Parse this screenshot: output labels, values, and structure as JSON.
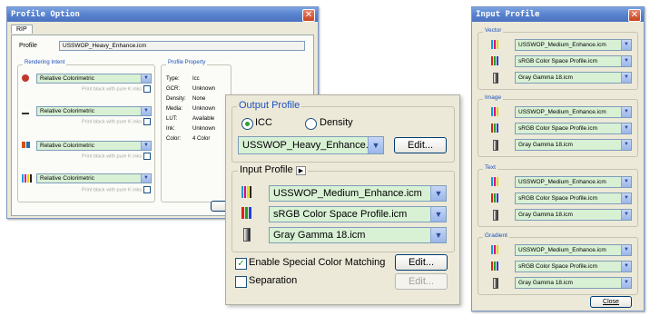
{
  "profile_option": {
    "title": "Profile Option",
    "tab": "RIP",
    "profile_label": "Profile",
    "profile_value": "USSWOP_Heavy_Enhance.icm",
    "rendering_intent": {
      "label": "Rendering Intent",
      "rows": [
        {
          "value": "Relative Colorimetric",
          "note": "Print black with pure K inks"
        },
        {
          "value": "Relative Colorimetric",
          "note": "Print black with pure K inks"
        },
        {
          "value": "Relative Colorimetric",
          "note": "Print black with pure K inks"
        },
        {
          "value": "Relative Colorimetric",
          "note": "Print black with pure K inks"
        }
      ]
    },
    "profile_property": {
      "label": "Profile Property",
      "rows": [
        {
          "key": "Type:",
          "value": "Icc"
        },
        {
          "key": "GCR:",
          "value": "Unknown"
        },
        {
          "key": "Density:",
          "value": "None"
        },
        {
          "key": "Media:",
          "value": "Unknown"
        },
        {
          "key": "LUT:",
          "value": "Available"
        },
        {
          "key": "Ink:",
          "value": "Unknown"
        },
        {
          "key": "Color:",
          "value": "4 Color"
        }
      ]
    },
    "partial_button": "C"
  },
  "output_profile": {
    "group_label": "Output Profile",
    "radio_icc": "ICC",
    "radio_density": "Density",
    "selected": "icc",
    "profile_value": "USSWOP_Heavy_Enhance.icr",
    "edit_button": "Edit...",
    "input_profile_label": "Input Profile",
    "input_rows": [
      "USSWOP_Medium_Enhance.icm",
      "sRGB Color Space Profile.icm",
      "Gray Gamma 18.icm"
    ],
    "special_color_label": "Enable Special Color Matching",
    "special_color_checked": true,
    "special_edit_button": "Edit...",
    "separation_label": "Separation",
    "separation_checked": false,
    "separation_edit_button": "Edit..."
  },
  "input_profile_window": {
    "title": "Input Profile",
    "groups": [
      {
        "label": "Vector",
        "rows": [
          "USSWOP_Medium_Enhance.icm",
          "sRGB Color Space Profile.icm",
          "Gray Gamma 18.icm"
        ]
      },
      {
        "label": "Image",
        "rows": [
          "USSWOP_Medium_Enhance.icm",
          "sRGB Color Space Profile.icm",
          "Gray Gamma 18.icm"
        ]
      },
      {
        "label": "Text",
        "rows": [
          "USSWOP_Medium_Enhance.icm",
          "sRGB Color Space Profile.icm",
          "Gray Gamma 18.icm"
        ]
      },
      {
        "label": "Gradient",
        "rows": [
          "USSWOP_Medium_Enhance.icm",
          "sRGB Color Space Profile.icm",
          "Gray Gamma 18.icm"
        ]
      }
    ],
    "close_button": "Close"
  },
  "colors": {
    "title_blue": "#5a84cf",
    "select_green": "#d8f0d4",
    "group_label_blue": "#1c50c0"
  },
  "icons": {
    "close": "close-icon",
    "dropdown": "chevron-down-icon",
    "expand": "triangle-right-icon",
    "cmyk_profile": "cmyk-bars-icon",
    "rgb_profile": "rgb-bars-icon",
    "gray_profile": "gray-bar-icon"
  }
}
